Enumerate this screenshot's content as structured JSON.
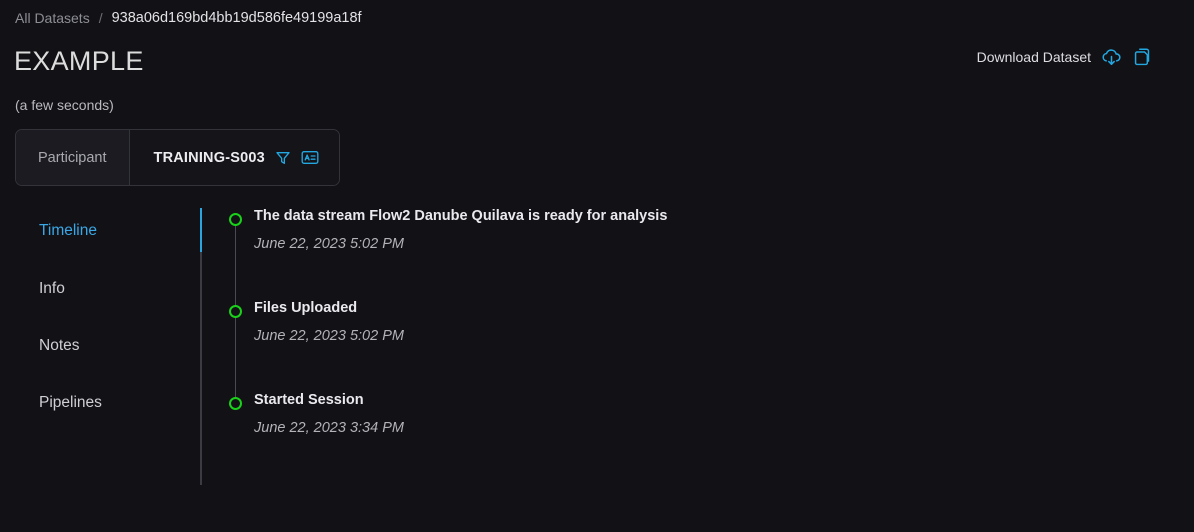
{
  "breadcrumb": {
    "root_label": "All Datasets",
    "separator": "/",
    "current": "938a06d169bd4bb19d586fe49199a18f"
  },
  "header": {
    "title": "EXAMPLE",
    "subtitle": "(a few seconds)",
    "download_label": "Download Dataset",
    "download_icon": "cloud-download-icon",
    "copy_icon": "copy-icon",
    "accent_color": "#23a7e0"
  },
  "participant": {
    "label": "Participant",
    "value": "TRAINING-S003",
    "filter_icon": "filter-funnel-icon",
    "id_icon": "id-badge-icon"
  },
  "sidebar": {
    "active_index": 0,
    "items": [
      {
        "label": "Timeline"
      },
      {
        "label": "Info"
      },
      {
        "label": "Notes"
      },
      {
        "label": "Pipelines"
      }
    ]
  },
  "timeline": {
    "marker_color": "#1ad11a",
    "events": [
      {
        "title": "The data stream Flow2 Danube Quilava is ready for analysis",
        "timestamp": "June 22, 2023 5:02 PM"
      },
      {
        "title": "Files Uploaded",
        "timestamp": "June 22, 2023 5:02 PM"
      },
      {
        "title": "Started Session",
        "timestamp": "June 22, 2023 3:34 PM"
      }
    ]
  }
}
